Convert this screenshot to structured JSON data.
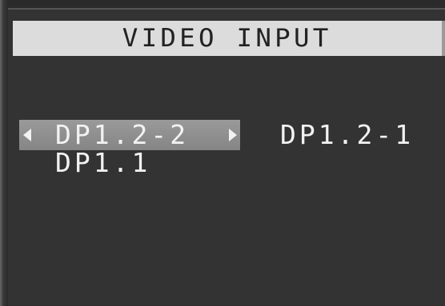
{
  "osd": {
    "title": "VIDEO INPUT",
    "inputs": [
      {
        "label": "DP1.2-2",
        "selected": true
      },
      {
        "label": "DP1.2-1",
        "selected": false
      },
      {
        "label": "DP1.1",
        "selected": false
      }
    ]
  },
  "colors": {
    "background": "#333333",
    "title_bar": "#dcdcdc",
    "title_text": "#222222",
    "highlight": "#8f8f8f",
    "text": "#f2f2f2"
  },
  "icons": {
    "left": "triangle-left-icon",
    "right": "triangle-right-icon"
  }
}
